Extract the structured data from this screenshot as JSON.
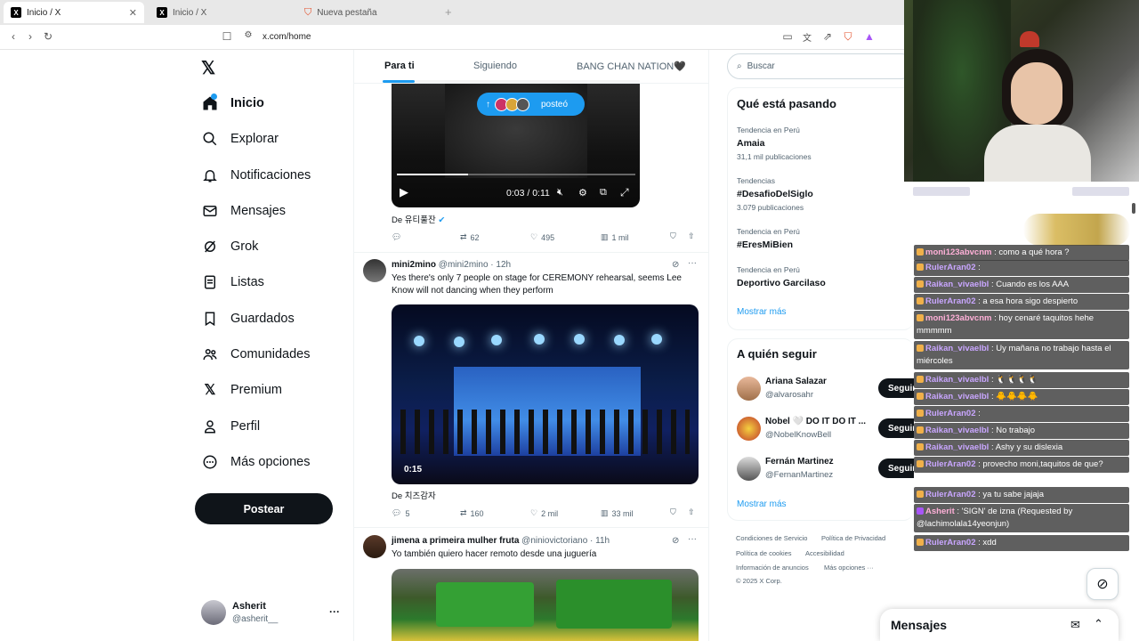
{
  "browser": {
    "tabs": [
      {
        "label": "Inicio / X",
        "active": true
      },
      {
        "label": "Inicio / X",
        "active": false
      },
      {
        "label": "Nueva pestaña",
        "active": false
      }
    ],
    "url": "x.com/home"
  },
  "nav": {
    "items": [
      {
        "label": "Inicio",
        "icon": "home-icon"
      },
      {
        "label": "Explorar",
        "icon": "search-icon"
      },
      {
        "label": "Notificaciones",
        "icon": "bell-icon"
      },
      {
        "label": "Mensajes",
        "icon": "mail-icon"
      },
      {
        "label": "Grok",
        "icon": "grok-icon"
      },
      {
        "label": "Listas",
        "icon": "list-icon"
      },
      {
        "label": "Guardados",
        "icon": "bookmark-icon"
      },
      {
        "label": "Comunidades",
        "icon": "communities-icon"
      },
      {
        "label": "Premium",
        "icon": "x-logo-icon"
      },
      {
        "label": "Perfil",
        "icon": "person-icon"
      },
      {
        "label": "Más opciones",
        "icon": "more-circle-icon"
      }
    ],
    "post_label": "Postear",
    "account_name": "Asherit",
    "account_handle": "@asherit__"
  },
  "feed": {
    "tabs": [
      "Para ti",
      "Siguiendo",
      "BANG CHAN NATION🖤"
    ],
    "posted_pill": "posteó",
    "tweet1": {
      "video_time": "0:03 / 0:11",
      "from_label": "De",
      "from_name": "유티풀잔",
      "replies": "",
      "retweets": "62",
      "likes": "495",
      "views": "1 mil"
    },
    "tweet2": {
      "name": "mini2mino",
      "handle": "@mini2mino · 12h",
      "text": "Yes there's only 7 people on stage for CEREMONY rehearsal, seems Lee Know will not dancing when they perform",
      "duration": "0:15",
      "from_label": "De",
      "from_name": "치즈감자",
      "replies": "5",
      "retweets": "160",
      "likes": "2 mil",
      "views": "33 mil"
    },
    "tweet3": {
      "name": "jimena a primeira mulher fruta",
      "handle": "@niniovictoriano · 11h",
      "text": "Yo también quiero hacer remoto desde una juguería"
    }
  },
  "right": {
    "search_placeholder": "Buscar",
    "trends_title": "Qué está pasando",
    "trends": [
      {
        "meta": "Tendencia en Perú",
        "title": "Amaia",
        "count": "31,1 mil publicaciones"
      },
      {
        "meta": "Tendencias",
        "title": "#DesafioDelSiglo",
        "count": "3.079 publicaciones"
      },
      {
        "meta": "Tendencia en Perú",
        "title": "#EresMiBien",
        "count": ""
      },
      {
        "meta": "Tendencia en Perú",
        "title": "Deportivo Garcilaso",
        "count": ""
      }
    ],
    "show_more": "Mostrar más",
    "follow_title": "A quién seguir",
    "follow": [
      {
        "name": "Ariana Salazar",
        "handle": "@alvarosahr",
        "button": "Seguir"
      },
      {
        "name": "Nobel 🤍 DO IT DO IT ...",
        "handle": "@NobelKnowBell",
        "button": "Seguir"
      },
      {
        "name": "Fernán Martinez",
        "handle": "@FernanMartinez",
        "button": "Seguir"
      }
    ],
    "show_more_2": "Mostrar más",
    "footer": [
      "Condiciones de Servicio",
      "Política de Privacidad",
      "Política de cookies",
      "Accesibilidad",
      "Información de anuncios",
      "Más opciones ···",
      "© 2025 X Corp."
    ]
  },
  "messages_label": "Mensajes",
  "stream": {
    "chat": [
      {
        "user": "moni123abvcnm",
        "msg": ": como a qué hora ?"
      },
      {
        "user": "RulerAran02",
        "msg": ":"
      },
      {
        "user": "Raikan_vivaelbl",
        "msg": ": Cuando es los AAA"
      },
      {
        "user": "RulerAran02",
        "msg": ": a esa hora sigo despierto"
      },
      {
        "user": "moni123abvcnm",
        "msg": ": hoy cenaré taquitos hehe mmmmm"
      },
      {
        "user": "Raikan_vivaelbl",
        "msg": ": Uy mañana no trabajo hasta el miércoles"
      },
      {
        "user": "Raikan_vivaelbl",
        "msg": ":"
      },
      {
        "user": "Raikan_vivaelbl",
        "msg": ":"
      },
      {
        "user": "RulerAran02",
        "msg": ":"
      },
      {
        "user": "Raikan_vivaelbl",
        "msg": ": No trabajo"
      },
      {
        "user": "Raikan_vivaelbl",
        "msg": ": Ashy y su dislexia"
      },
      {
        "user": "RulerAran02",
        "msg": ": provecho moni,taquitos de que?"
      },
      {
        "user": "RulerAran02",
        "msg": ": ya tu sabe jajaja"
      },
      {
        "user": "Asherit",
        "msg": ": 'SIGN' de izna (Requested by @lachimolala14yeonjun)"
      },
      {
        "user": "RulerAran02",
        "msg": ": xdd"
      }
    ]
  }
}
